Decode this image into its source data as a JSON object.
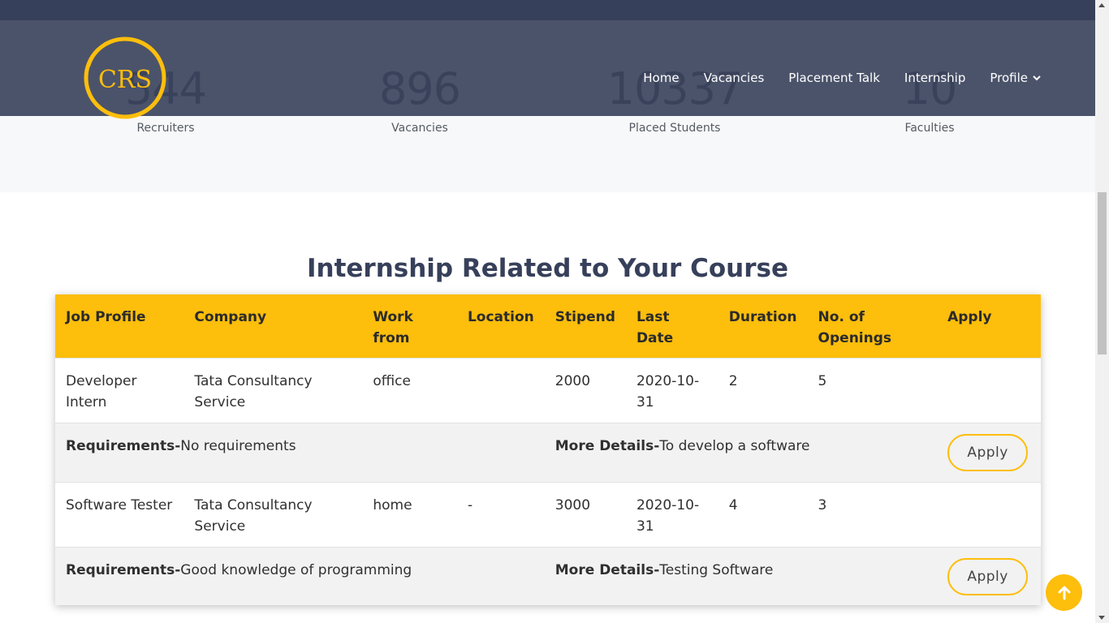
{
  "brand": {
    "logo_text": "CRS"
  },
  "nav": {
    "items": [
      {
        "label": "Home"
      },
      {
        "label": "Vacancies"
      },
      {
        "label": "Placement Talk"
      },
      {
        "label": "Internship"
      },
      {
        "label": "Profile"
      }
    ]
  },
  "stats": [
    {
      "value": "544",
      "label": "Recruiters"
    },
    {
      "value": "896",
      "label": "Vacancies"
    },
    {
      "value": "10337",
      "label": "Placed Students"
    },
    {
      "value": "10",
      "label": "Faculties"
    }
  ],
  "section": {
    "title": "Internship Related to Your Course"
  },
  "table": {
    "headers": [
      "Job Profile",
      "Company",
      "Work from",
      "Location",
      "Stipend",
      "Last Date",
      "Duration",
      "No. of Openings",
      "Apply"
    ],
    "rows": [
      {
        "job_profile": "Developer Intern",
        "company": "Tata Consultancy Service",
        "work_from": "office",
        "location": "",
        "stipend": "2000",
        "last_date": "2020-10-31",
        "duration": "2",
        "openings": "5",
        "requirements_label": "Requirements-",
        "requirements": "No requirements",
        "details_label": "More Details-",
        "details": "To develop a software",
        "apply_label": "Apply"
      },
      {
        "job_profile": "Software Tester",
        "company": "Tata Consultancy Service",
        "work_from": "home",
        "location": "-",
        "stipend": "3000",
        "last_date": "2020-10-31",
        "duration": "4",
        "openings": "3",
        "requirements_label": "Requirements-",
        "requirements": "Good knowledge of programming",
        "details_label": "More Details-",
        "details": "Testing Software",
        "apply_label": "Apply"
      }
    ]
  },
  "colors": {
    "accent": "#fdbe0c",
    "header": "#37405a"
  }
}
